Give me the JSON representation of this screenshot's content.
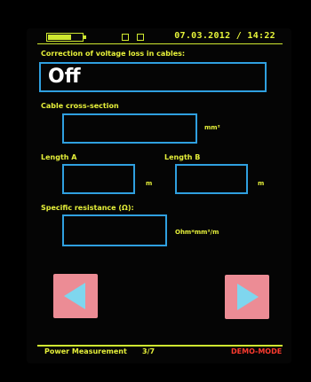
{
  "status": {
    "datetime": "07.03.2012 / 14:22"
  },
  "form": {
    "correction_label": "Correction of voltage loss in cables:",
    "correction_value": "Off",
    "cross_section_label": "Cable cross-section",
    "cross_section_value": "",
    "cross_section_unit": "mm²",
    "length_a_label": "Length A",
    "length_a_value": "",
    "length_a_unit": "m",
    "length_b_label": "Length B",
    "length_b_value": "",
    "length_b_unit": "m",
    "resistance_label": "Specific resistance (Ω):",
    "resistance_value": "",
    "resistance_unit": "Ohm*mm²/m"
  },
  "footer": {
    "mode_title": "Power Measurement",
    "page": "3/7",
    "demo_label": "DEMO-MODE"
  },
  "colors": {
    "accent": "#cfe830",
    "field_border": "#2fa0e0",
    "demo": "#ff3b2f",
    "button_bg": "#ec8c95",
    "arrow": "#7fd6ee"
  },
  "icons": {
    "prev": "left-arrow-icon",
    "next": "right-arrow-icon",
    "battery": "battery-icon"
  }
}
